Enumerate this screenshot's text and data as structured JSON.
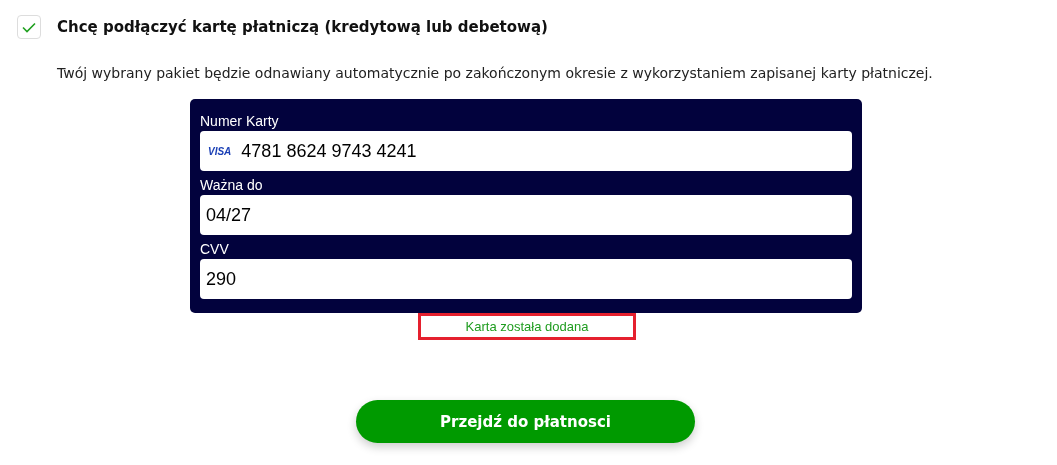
{
  "consent": {
    "checked": true,
    "label": "Chcę podłączyć kartę płatniczą (kredytową lub debetową)"
  },
  "info": "Twój wybrany pakiet będzie odnawiany automatycznie po zakończonym okresie z wykorzystaniem zapisanej karty płatniczej.",
  "card_form": {
    "fields": [
      {
        "label": "Numer Karty",
        "value": "4781 8624 9743 4241",
        "brand": "VISA"
      },
      {
        "label": "Ważna do",
        "value": "04/27"
      },
      {
        "label": "CVV",
        "value": "290"
      }
    ]
  },
  "status": {
    "text": "Karta została dodana",
    "highlighted": true
  },
  "submit_button": "Przejdź do płatnosci"
}
